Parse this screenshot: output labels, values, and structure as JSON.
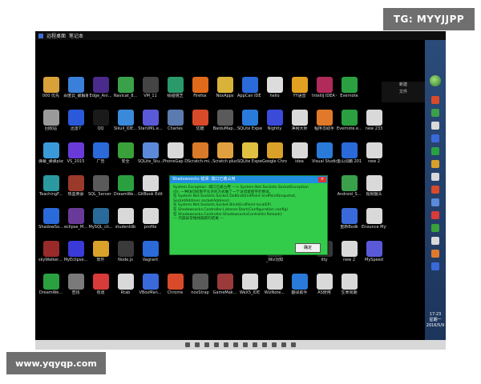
{
  "watermark_top": "TG: MYYJJPP",
  "watermark_bottom": "www.yqyqp.com",
  "topbar": {
    "title_1": "远程桌面",
    "title_2": "笔记本"
  },
  "context_menu": {
    "item_1": "新建",
    "item_2": "文件"
  },
  "desktop_icons": [
    {
      "label": "000 优先",
      "color": "#d9a13a"
    },
    {
      "label": "百度云_破解版_绿色",
      "color": "#3a7fd9"
    },
    {
      "label": "Edge_Ani...",
      "color": "#4a2a8a"
    },
    {
      "label": "Navicat_8...",
      "color": "#3aa04a"
    },
    {
      "label": "VM_11",
      "color": "#444"
    },
    {
      "label": "绘碰镜芝",
      "color": "#2a9a6a"
    },
    {
      "label": "Firefox",
      "color": "#e06a1a"
    },
    {
      "label": "NoxApps",
      "color": "#d9b23a"
    },
    {
      "label": "AppCan IDE 个人版 v3...",
      "color": "#2a6ad9"
    },
    {
      "label": "hello",
      "color": "#dcdcdc"
    },
    {
      "label": "YY语音",
      "color": "#e0a020"
    },
    {
      "label": "IntelliJ IDEA Communit...",
      "color": "#b02a5a"
    },
    {
      "label": "Evernote",
      "color": "#2aa040"
    },
    {
      "label": "",
      "color": "#000"
    },
    {
      "label": "回收站",
      "color": "#9a9a9a"
    },
    {
      "label": "迅雷7",
      "color": "#2a5ad9"
    },
    {
      "label": "QQ",
      "color": "#1a1a1a"
    },
    {
      "label": "Sikuli_IDE...",
      "color": "#3a8ad9"
    },
    {
      "label": "StarUML.e...",
      "color": "#5a5ad9"
    },
    {
      "label": "Charles",
      "color": "#5a7ab0"
    },
    {
      "label": "优酷",
      "color": "#d94a2a"
    },
    {
      "label": "BaiduMap...",
      "color": "#5a5a5a"
    },
    {
      "label": "SQLite Expert Per...",
      "color": "#2a7ad9"
    },
    {
      "label": "Nightly",
      "color": "#3a4ad9"
    },
    {
      "label": "净网大师",
      "color": "#d9d9d9"
    },
    {
      "label": "程序员助手",
      "color": "#e07a2a"
    },
    {
      "label": "Evernote.e...",
      "color": "#2aa040"
    },
    {
      "label": "new 233",
      "color": "#d9d9d9"
    },
    {
      "label": "弹幕_弹弹play",
      "color": "#3a9ad9"
    },
    {
      "label": "VS_2015",
      "color": "#6a3ad9"
    },
    {
      "label": "广告",
      "color": "#2a6ad9"
    },
    {
      "label": "安全",
      "color": "#3aa03a"
    },
    {
      "label": "SQLite_Stu...",
      "color": "#5a8ad9"
    },
    {
      "label": "PhoneGap D...",
      "color": "#d9d9d9"
    },
    {
      "label": "Scratch-mi...",
      "color": "#d97a2a"
    },
    {
      "label": "Scratch plus",
      "color": "#e0a040"
    },
    {
      "label": "SQLite Expert Per...",
      "color": "#e0c040"
    },
    {
      "label": "Google Chrome C...",
      "color": "#d9a02a"
    },
    {
      "label": "idea",
      "color": "#d9d9d9"
    },
    {
      "label": "Visual Studio Co...",
      "color": "#2a7ad9"
    },
    {
      "label": "金山词霸 2016",
      "color": "#2a6ad9"
    },
    {
      "label": "new 2",
      "color": "#d9d9d9"
    },
    {
      "label": "TeachingF...",
      "color": "#2a9aa0"
    },
    {
      "label": "热血英豪",
      "color": "#9a3a2a"
    },
    {
      "label": "SQL_Server 2014_Studio",
      "color": "#5a5a5a"
    },
    {
      "label": "DreamWe...",
      "color": "#2aa040"
    },
    {
      "label": "GitBook Editor",
      "color": "#d9d9d9"
    },
    {
      "label": "",
      "color": "#000"
    },
    {
      "label": "",
      "color": "#000"
    },
    {
      "label": "",
      "color": "#000"
    },
    {
      "label": "",
      "color": "#000"
    },
    {
      "label": "",
      "color": "#000"
    },
    {
      "label": "",
      "color": "#000"
    },
    {
      "label": "",
      "color": "#000"
    },
    {
      "label": "Android_S...",
      "color": "#3aa04a"
    },
    {
      "label": "视频摄头",
      "color": "#d9d9d9"
    },
    {
      "label": "ShadowSo...",
      "color": "#2a6ad9"
    },
    {
      "label": "eclipse_M...",
      "color": "#6a3a9a"
    },
    {
      "label": "MySQL_cli...",
      "color": "#2a6a9a"
    },
    {
      "label": "studentdb",
      "color": "#d9d9d9"
    },
    {
      "label": "profile",
      "color": "#d9d9d9"
    },
    {
      "label": "",
      "color": "#000"
    },
    {
      "label": "",
      "color": "#000"
    },
    {
      "label": "",
      "color": "#000"
    },
    {
      "label": "",
      "color": "#000"
    },
    {
      "label": "",
      "color": "#000"
    },
    {
      "label": "",
      "color": "#000"
    },
    {
      "label": "",
      "color": "#000"
    },
    {
      "label": "重新Bodk",
      "color": "#3a6ad9"
    },
    {
      "label": "Enounce MySpeed",
      "color": "#d9d9d9"
    },
    {
      "label": "skyWalker... 天行",
      "color": "#9a2a2a"
    },
    {
      "label": "MyEclipse...",
      "color": "#3a3ad9"
    },
    {
      "label": "软件",
      "color": "#d9a02a"
    },
    {
      "label": "Node.js",
      "color": "#3a3a3a"
    },
    {
      "label": "Vagrant",
      "color": "#2a6ad9"
    },
    {
      "label": "",
      "color": "#000"
    },
    {
      "label": "",
      "color": "#000"
    },
    {
      "label": "",
      "color": "#000"
    },
    {
      "label": "",
      "color": "#000"
    },
    {
      "label": "_Wiz功知",
      "color": "#3a3a3a"
    },
    {
      "label": "",
      "color": "#000"
    },
    {
      "label": "itty",
      "color": "#3a3a3a"
    },
    {
      "label": "new 2",
      "color": "#d9d9d9"
    },
    {
      "label": "MySpeed",
      "color": "#5a5ad9"
    },
    {
      "label": "DreamWe...",
      "color": "#2aa040"
    },
    {
      "label": "查找",
      "color": "#7a7a7a"
    },
    {
      "label": "有道",
      "color": "#d93a3a"
    },
    {
      "label": "Rtab",
      "color": "#d9d9d9"
    },
    {
      "label": "VBoxMan...",
      "color": "#3a6ad9"
    },
    {
      "label": "Chrome",
      "color": "#d94a2a"
    },
    {
      "label": "noxStrap",
      "color": "#5a5a5a"
    },
    {
      "label": "GameMak...",
      "color": "#9a3a3a"
    },
    {
      "label": "WeX5_IDE",
      "color": "#d9d9d9"
    },
    {
      "label": "WizNote...",
      "color": "#d9d9d9"
    },
    {
      "label": "翻译助手",
      "color": "#2a7ad9"
    },
    {
      "label": "AS使用",
      "color": "#d9d9d9"
    },
    {
      "label": "生命周期",
      "color": "#d9d9d9"
    },
    {
      "label": "",
      "color": "#000"
    }
  ],
  "dialog": {
    "title": "Shadowsocks 错误: 端口已被占用",
    "close": "×",
    "lines": [
      "System.Exception: 端口已被占用 ---> System.Net.Sockets.SocketException",
      "(0): 一种访问权限不允许的方式做了一个访问套接字的尝试。",
      "   在 System.Net.Sockets.Socket.DoBind(EndPoint endPointSnapshot,",
      "SocketAddress socketAddress)",
      "   在 System.Net.Sockets.Socket.Bind(EndPoint localEP)",
      "   在 Shadowsocks.Controller.Listener.Start(Configuration config)",
      "   在 Shadowsocks.Controller.ShadowsocksController.Reload()",
      "   --- 内部异常堆栈跟踪的结尾 ---"
    ],
    "ok_button": "确定"
  },
  "tray": {
    "time": "17:23",
    "weekday": "星期一",
    "date": "2016/5/9"
  }
}
